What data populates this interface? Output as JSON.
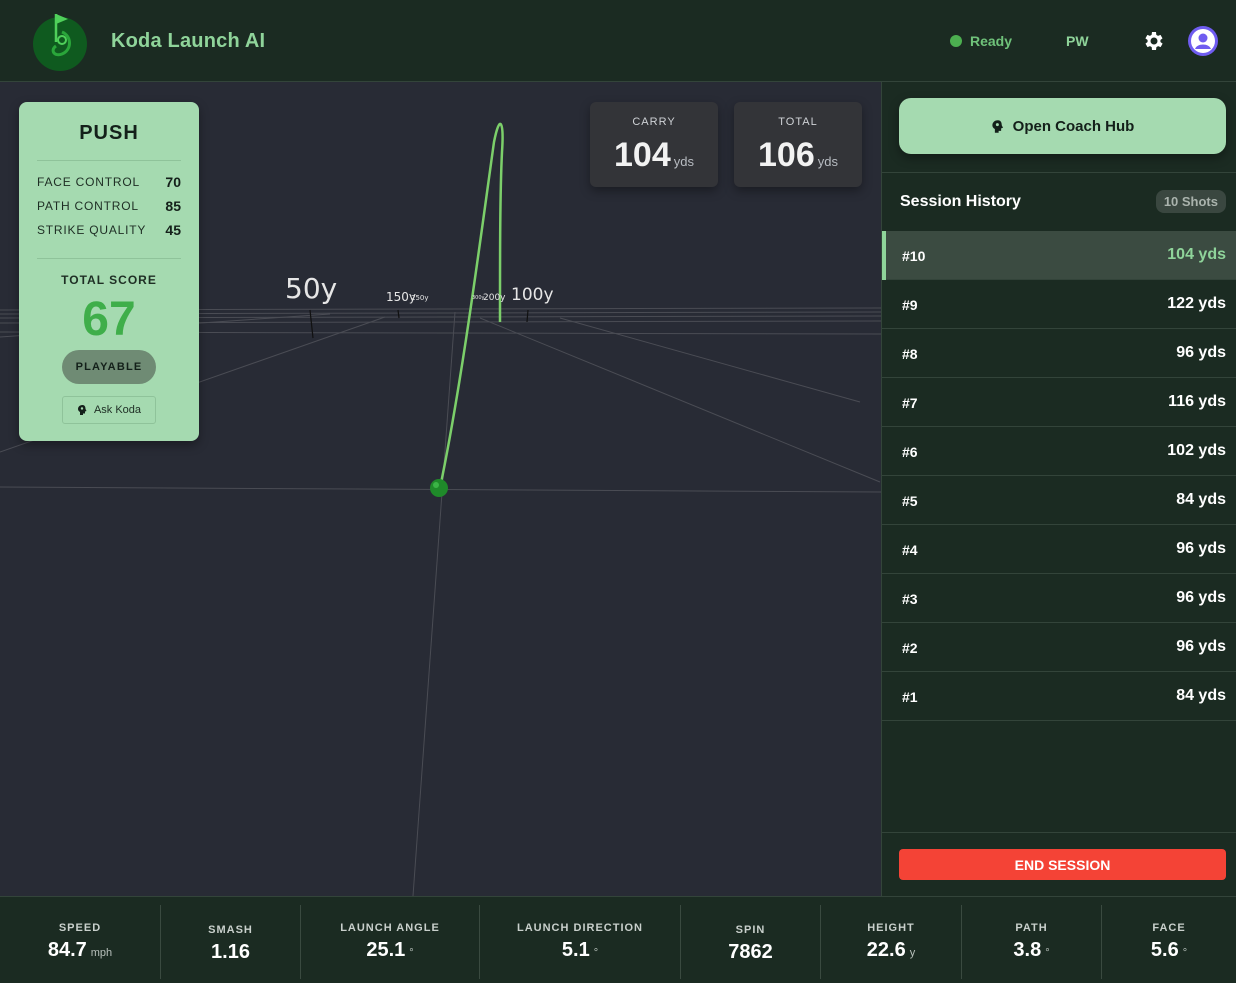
{
  "header": {
    "title": "Koda Launch AI",
    "status_text": "Ready",
    "club": "PW",
    "status_color": "#4caf50",
    "settings_icon": "gear-icon",
    "avatar_icon": "user-icon"
  },
  "scene": {
    "distance_labels": [
      "50y",
      "150y",
      "250y",
      "300y",
      "200y",
      "100y"
    ],
    "trajectory_color": "#7ccf6a",
    "ball_color": "#1f8a2a"
  },
  "score_card": {
    "shot_type": "PUSH",
    "metrics": [
      {
        "name": "FACE CONTROL",
        "value": "70"
      },
      {
        "name": "PATH CONTROL",
        "value": "85"
      },
      {
        "name": "STRIKE QUALITY",
        "value": "45"
      }
    ],
    "total_label": "TOTAL SCORE",
    "total_score": "67",
    "rating": "PLAYABLE",
    "ask_label": "Ask Koda",
    "ask_icon": "brain-icon"
  },
  "carry": {
    "label": "CARRY",
    "value": "104",
    "unit": "yds"
  },
  "total": {
    "label": "TOTAL",
    "value": "106",
    "unit": "yds"
  },
  "sidebar": {
    "coach_label": "Open Coach Hub",
    "coach_icon": "brain-icon",
    "session_title": "Session History",
    "shots_count": "10 Shots",
    "history": [
      {
        "id": "#10",
        "yds": "104 yds"
      },
      {
        "id": "#9",
        "yds": "122 yds"
      },
      {
        "id": "#8",
        "yds": "96 yds"
      },
      {
        "id": "#7",
        "yds": "116 yds"
      },
      {
        "id": "#6",
        "yds": "102 yds"
      },
      {
        "id": "#5",
        "yds": "84 yds"
      },
      {
        "id": "#4",
        "yds": "96 yds"
      },
      {
        "id": "#3",
        "yds": "96 yds"
      },
      {
        "id": "#2",
        "yds": "96 yds"
      },
      {
        "id": "#1",
        "yds": "84 yds"
      }
    ],
    "end_label": "END SESSION"
  },
  "bottom": {
    "speed": {
      "label": "SPEED",
      "value": "84.7",
      "unit": "mph"
    },
    "smash": {
      "label": "SMASH",
      "value": "1.16",
      "unit": ""
    },
    "launch_angle": {
      "label": "LAUNCH ANGLE",
      "value": "25.1",
      "unit": "°"
    },
    "launch_direction": {
      "label": "LAUNCH DIRECTION",
      "value": "5.1",
      "unit": "°"
    },
    "spin": {
      "label": "SPIN",
      "value": "7862",
      "unit": ""
    },
    "height": {
      "label": "HEIGHT",
      "value": "22.6",
      "unit": "y"
    },
    "path": {
      "label": "PATH",
      "value": "3.8",
      "unit": "°"
    },
    "face": {
      "label": "FACE",
      "value": "5.6",
      "unit": "°"
    }
  }
}
